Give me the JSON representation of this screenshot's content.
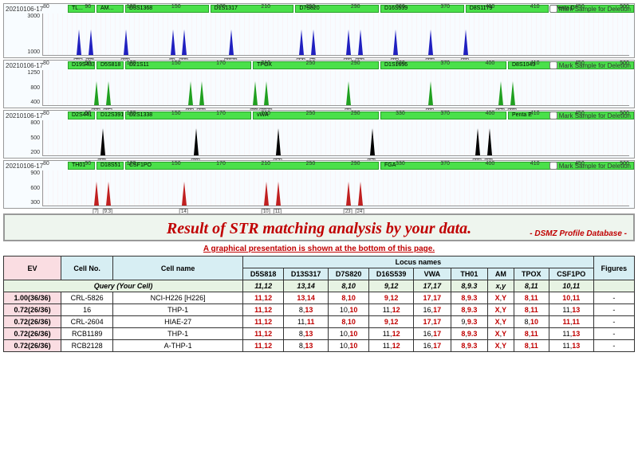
{
  "panels": [
    {
      "id": "20210106-17",
      "mark_label": "Mark Sample for Deletion",
      "loci": [
        "TL...",
        "AM...",
        "D3S1368",
        "D1S1317",
        "D7S820",
        "D16S539",
        "D8S1179",
        "Penta D"
      ],
      "y": [
        "3000",
        "1000"
      ],
      "x": [
        "80",
        "90",
        "120",
        "150",
        "170",
        "210",
        "250",
        "290",
        "330",
        "370",
        "400",
        "410",
        "450",
        "500"
      ],
      "peak_color": "blue",
      "peaks": [
        6,
        8,
        14,
        22,
        24,
        32,
        44,
        46,
        52,
        54,
        60,
        66,
        72
      ],
      "peak_labels": [
        "TL",
        "13",
        "13",
        "8",
        "10",
        "10.2",
        "14",
        "7",
        "11",
        "12",
        "11",
        "10",
        "11"
      ]
    },
    {
      "id": "20210106-17",
      "mark_label": "Mark Sample for Deletion",
      "loci": [
        "D19S433",
        "D5S818",
        "D21S11",
        "TPOX",
        "D1S1656",
        "D8S1043"
      ],
      "y": [
        "1250",
        "800",
        "400"
      ],
      "x": [
        "80",
        "90",
        "120",
        "150",
        "170",
        "210",
        "250",
        "290",
        "330",
        "370",
        "400",
        "410",
        "450",
        "500"
      ],
      "peak_color": "green",
      "peaks": [
        9,
        11,
        25,
        27,
        36,
        38,
        52,
        66,
        78,
        80
      ],
      "peak_labels": [
        "13",
        "15",
        "11",
        "12",
        "29",
        "33.2",
        "8",
        "11",
        "17",
        "18"
      ]
    },
    {
      "id": "20210106-17",
      "mark_label": "Mark Sample for Deletion",
      "loci": [
        "D2S441",
        "D12S391",
        "D2S1338",
        "vWA",
        "",
        "Penta E"
      ],
      "y": [
        "800",
        "500",
        "200"
      ],
      "x": [
        "80",
        "90",
        "120",
        "150",
        "170",
        "210",
        "250",
        "290",
        "330",
        "370",
        "400",
        "410",
        "450",
        "500"
      ],
      "peak_color": "black",
      "peaks": [
        10,
        26,
        40,
        56,
        74,
        76
      ],
      "peak_labels": [
        "12",
        "23",
        "17",
        "17",
        "10",
        "12"
      ]
    },
    {
      "id": "20210106-17",
      "mark_label": "Mark Sample for Deletion",
      "loci": [
        "TH01",
        "D18S51",
        "CSF1PO",
        "FGA"
      ],
      "y": [
        "900",
        "600",
        "300"
      ],
      "x": [
        "80",
        "90",
        "120",
        "150",
        "170",
        "210",
        "250",
        "290",
        "330",
        "370",
        "400",
        "410",
        "450",
        "500"
      ],
      "peak_color": "red",
      "peaks": [
        9,
        11,
        24,
        38,
        40,
        52,
        54
      ],
      "peak_labels": [
        "7",
        "9.3",
        "14",
        "10",
        "11",
        "23",
        "24"
      ]
    }
  ],
  "result_title": "Result of STR matching analysis by your data.",
  "db_label": "- DSMZ Profile Database -",
  "subtitle": "A graphical presentation is shown at the bottom of this page.",
  "headers": {
    "ev": "EV",
    "cell_no": "Cell No.",
    "cell_name": "Cell name",
    "locus_group": "Locus names",
    "figures": "Figures",
    "loci": [
      "D5S818",
      "D13S317",
      "D7S820",
      "D16S539",
      "VWA",
      "TH01",
      "AM",
      "TPOX",
      "CSF1PO"
    ]
  },
  "query_label": "Query (Your Cell)",
  "query_values": [
    "11,12",
    "13,14",
    "8,10",
    "9,12",
    "17,17",
    "8,9.3",
    "x,y",
    "8,11",
    "10,11"
  ],
  "rows": [
    {
      "ev": "1.00(36/36)",
      "cell_no": "CRL-5826",
      "cell_name": "NCI-H226 [H226]",
      "vals": [
        [
          "11",
          "12"
        ],
        [
          "13",
          "14"
        ],
        [
          "8",
          "10"
        ],
        [
          "9",
          "12"
        ],
        [
          "17",
          "17"
        ],
        [
          "8",
          "9.3"
        ],
        [
          "X",
          "Y"
        ],
        [
          "8",
          "11"
        ],
        [
          "10",
          "11"
        ]
      ],
      "fig": "-"
    },
    {
      "ev": "0.72(26/36)",
      "cell_no": "16",
      "cell_name": "THP-1",
      "vals": [
        [
          "11",
          "12"
        ],
        [
          "",
          "8,13"
        ],
        [
          "",
          "10,10"
        ],
        [
          "",
          "11,12"
        ],
        [
          "",
          "16,17"
        ],
        [
          "8",
          "9.3"
        ],
        [
          "X",
          "Y"
        ],
        [
          "8",
          "11"
        ],
        [
          "",
          "11,13"
        ]
      ],
      "fig": "-"
    },
    {
      "ev": "0.72(26/36)",
      "cell_no": "CRL-2604",
      "cell_name": "HIAE-27",
      "vals": [
        [
          "11",
          "12"
        ],
        [
          "",
          "11,11"
        ],
        [
          "8",
          "10"
        ],
        [
          "9",
          "12"
        ],
        [
          "17",
          "17"
        ],
        [
          "",
          "9,9.3"
        ],
        [
          "X",
          "Y"
        ],
        [
          "",
          "8,10"
        ],
        [
          "11",
          "11"
        ]
      ],
      "fig": "-"
    },
    {
      "ev": "0.72(26/36)",
      "cell_no": "RCB1189",
      "cell_name": "THP-1",
      "vals": [
        [
          "11",
          "12"
        ],
        [
          "",
          "8,13"
        ],
        [
          "",
          "10,10"
        ],
        [
          "",
          "11,12"
        ],
        [
          "",
          "16,17"
        ],
        [
          "8",
          "9.3"
        ],
        [
          "X",
          "Y"
        ],
        [
          "8",
          "11"
        ],
        [
          "",
          "11,13"
        ]
      ],
      "fig": "-"
    },
    {
      "ev": "0.72(26/36)",
      "cell_no": "RCB2128",
      "cell_name": "A-THP-1",
      "vals": [
        [
          "11",
          "12"
        ],
        [
          "",
          "8,13"
        ],
        [
          "",
          "10,10"
        ],
        [
          "",
          "11,12"
        ],
        [
          "",
          "16,17"
        ],
        [
          "8",
          "9.3"
        ],
        [
          "X",
          "Y"
        ],
        [
          "8",
          "11"
        ],
        [
          "",
          "11,13"
        ]
      ],
      "fig": "-"
    }
  ]
}
